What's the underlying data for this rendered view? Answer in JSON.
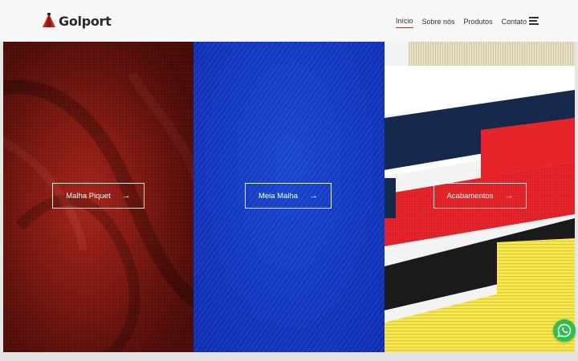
{
  "brand": {
    "name": "Golport",
    "accent_color": "#c9281f"
  },
  "nav": {
    "items": [
      {
        "label": "Início",
        "active": true
      },
      {
        "label": "Sobre nós",
        "active": false
      },
      {
        "label": "Produtos",
        "active": false
      },
      {
        "label": "Contato",
        "active": false
      }
    ],
    "menu_icon": "hamburger-icon"
  },
  "panels": [
    {
      "label": "Malha Piquet",
      "color": "#9a1f16",
      "icon": "arrow-right-icon"
    },
    {
      "label": "Meia Malha",
      "color": "#1741d2",
      "icon": "arrow-right-icon"
    },
    {
      "label": "Acabamentos",
      "color": "#f1f1f1",
      "icon": "arrow-right-icon"
    }
  ],
  "whatsapp": {
    "icon": "whatsapp-icon",
    "color": "#2fbf4f"
  }
}
